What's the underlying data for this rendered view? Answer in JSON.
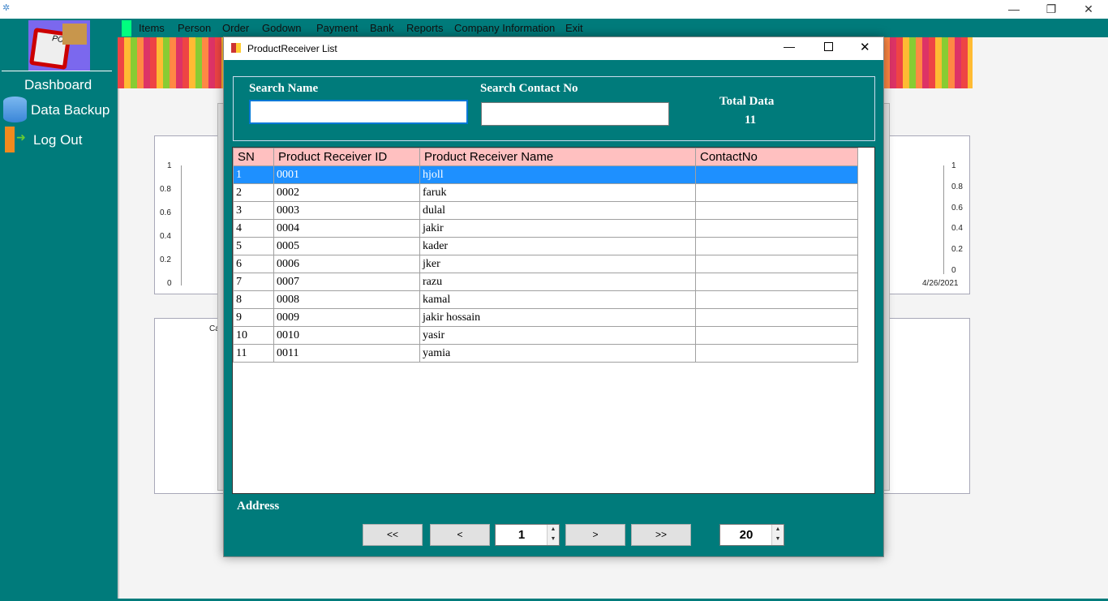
{
  "window": {
    "minimize": "—",
    "restore": "❐",
    "close": "✕"
  },
  "sidebar": {
    "items": [
      {
        "label": "Dashboard"
      },
      {
        "label": "Data Backup",
        "icon": "database-icon"
      },
      {
        "label": "Log Out",
        "icon": "door-exit-icon"
      }
    ],
    "logo_text": "PO"
  },
  "menu": [
    "Items",
    "Person",
    "Order",
    "Godown",
    "Payment",
    "Bank",
    "Reports",
    "Company Information",
    "Exit"
  ],
  "background_chart": {
    "y_ticks": [
      "1",
      "0.8",
      "0.6",
      "0.4",
      "0.2",
      "0"
    ],
    "y_ticks_right": [
      "1",
      "0.8",
      "0.6",
      "0.4",
      "0.2",
      "0"
    ],
    "x_label": "4/26/2021",
    "chart2_label": "Ca"
  },
  "dialog": {
    "title": "ProductReceiver List",
    "search_name_label": "Search Name",
    "search_name_value": "",
    "search_contact_label": "Search Contact No",
    "search_contact_value": "",
    "total_label": "Total Data",
    "total_value": "11",
    "address_label": "Address",
    "columns": [
      "SN",
      "Product Receiver ID",
      "Product Receiver Name",
      "ContactNo"
    ],
    "rows": [
      [
        "1",
        "0001",
        "hjoll",
        ""
      ],
      [
        "2",
        "0002",
        "faruk",
        ""
      ],
      [
        "3",
        "0003",
        "dulal",
        ""
      ],
      [
        "4",
        "0004",
        "jakir",
        ""
      ],
      [
        "5",
        "0005",
        "kader",
        ""
      ],
      [
        "6",
        "0006",
        "jker",
        ""
      ],
      [
        "7",
        "0007",
        "razu",
        ""
      ],
      [
        "8",
        "0008",
        "kamal",
        ""
      ],
      [
        "9",
        "0009",
        "jakir hossain",
        ""
      ],
      [
        "10",
        "0010",
        "yasir",
        ""
      ],
      [
        "11",
        "0011",
        "yamia",
        ""
      ]
    ],
    "pager": {
      "first": "<<",
      "prev": "<",
      "page": "1",
      "next": ">",
      "last": ">>",
      "page_size": "20"
    }
  },
  "colors": {
    "teal": "#007b7b",
    "header_pink": "#ffc0c0",
    "selection": "#1e90ff"
  }
}
